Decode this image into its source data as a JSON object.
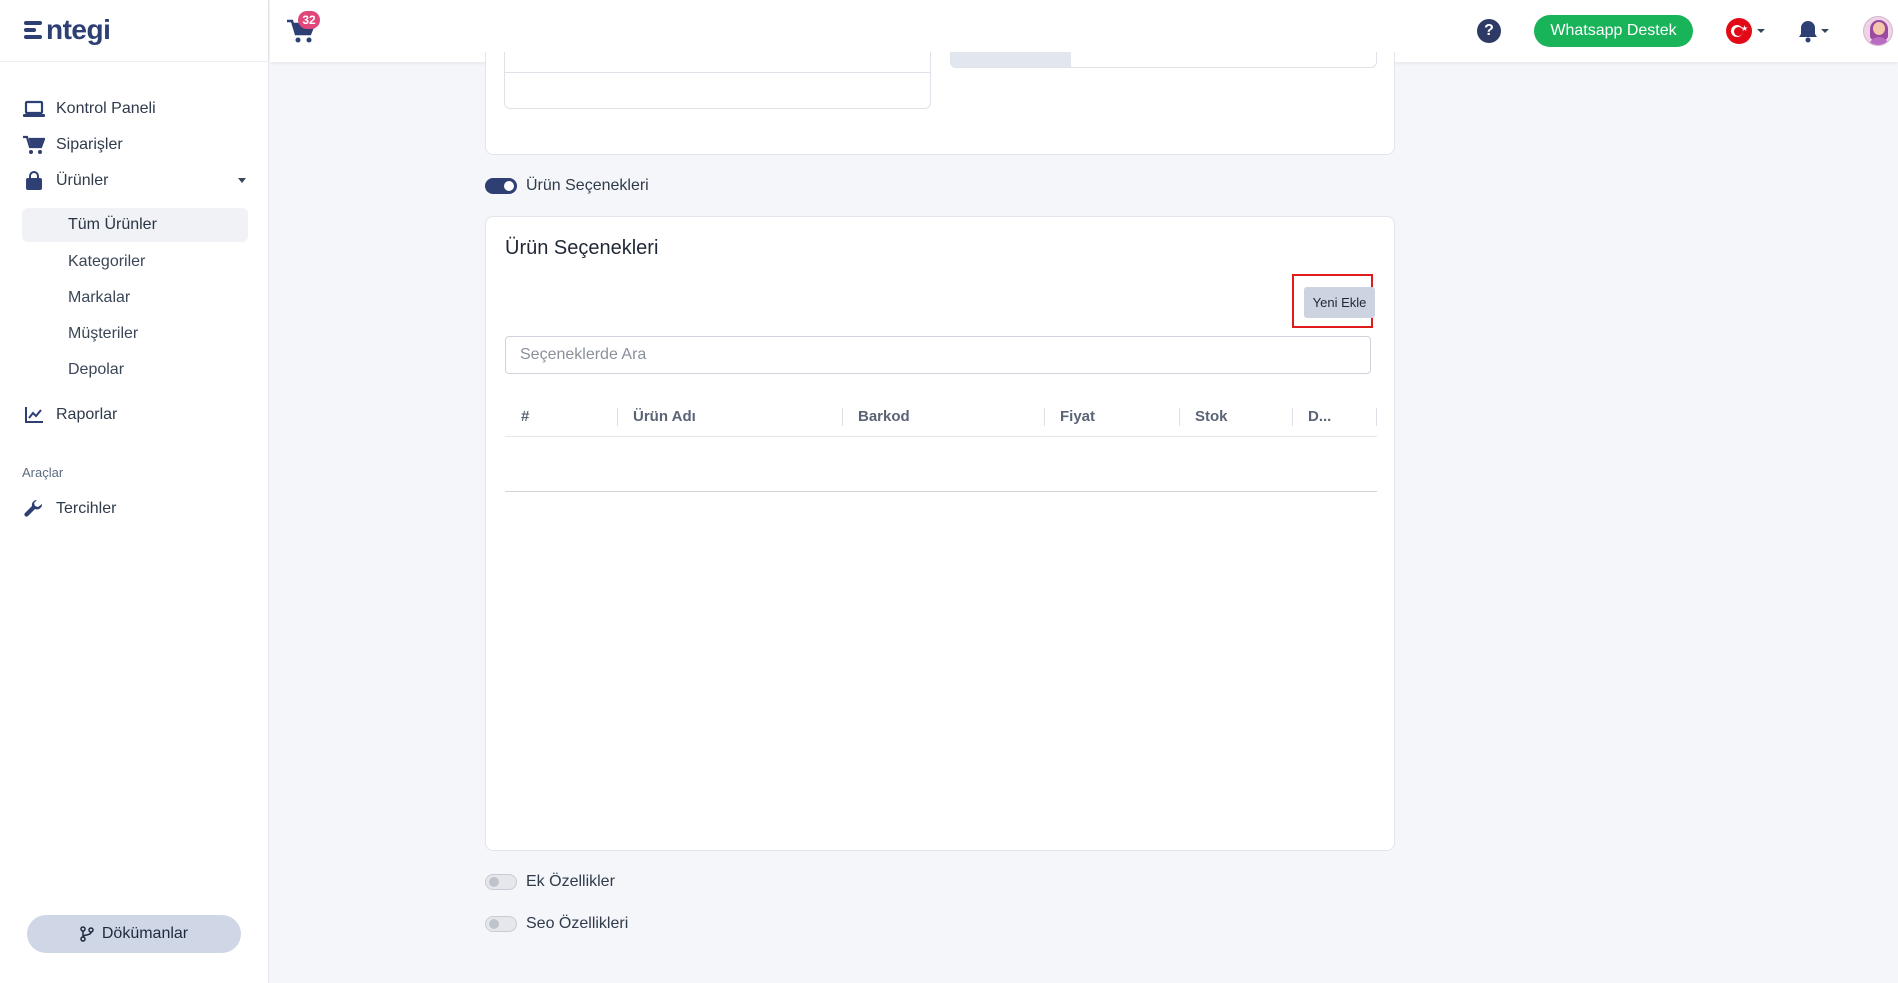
{
  "brand": {
    "logo_text": "ntegi"
  },
  "sidebar": {
    "items": [
      {
        "label": "Kontrol Paneli",
        "icon": "laptop-icon"
      },
      {
        "label": "Siparişler",
        "icon": "cart-icon"
      },
      {
        "label": "Ürünler",
        "icon": "bag-icon"
      }
    ],
    "sub_items": [
      {
        "label": "Tüm Ürünler",
        "active": true
      },
      {
        "label": "Kategoriler"
      },
      {
        "label": "Markalar"
      },
      {
        "label": "Müşteriler"
      },
      {
        "label": "Depolar"
      }
    ],
    "reports": {
      "label": "Raporlar",
      "icon": "chart-line-icon"
    },
    "section_label": "Araçlar",
    "preferences": {
      "label": "Tercihler",
      "icon": "wrench-icon"
    },
    "docs_button": "Dökümanlar"
  },
  "topbar": {
    "cart_count": "32",
    "help": "?",
    "whatsapp_label": "Whatsapp Destek",
    "colors": {
      "whatsapp": "#19b35a",
      "badge": "#e0467a",
      "primary": "#2d3f73"
    }
  },
  "main": {
    "toggle_options_label": "Ürün Seçenekleri",
    "options_card": {
      "title": "Ürün Seçenekleri",
      "new_button": "Yeni Ekle",
      "search_placeholder": "Seçeneklerde Ara",
      "columns": [
        "#",
        "Ürün Adı",
        "Barkod",
        "Fiyat",
        "Stok",
        "D..."
      ]
    },
    "toggle_extra_label": "Ek Özellikler",
    "toggle_seo_label": "Seo Özellikleri"
  }
}
